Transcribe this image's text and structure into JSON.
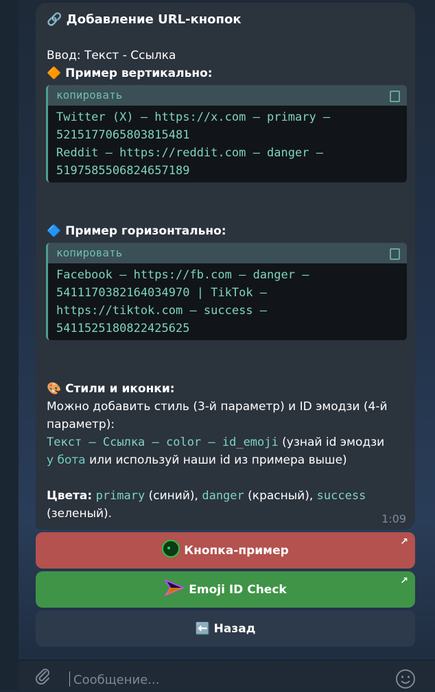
{
  "message": {
    "title": "🔗 Добавление URL-кнопок",
    "input_format": "Ввод: Текст - Ссылка",
    "vertical_heading": "🔶 Пример вертикально:",
    "copy_label": "копировать",
    "vertical_code": [
      "Twitter (X) — https://x.com — primary —",
      "5215177065803815481",
      "Reddit — https://reddit.com — danger —",
      "5197585506824657189"
    ],
    "horizontal_heading": "🔷 Пример горизонтально:",
    "horizontal_code": [
      "Facebook — https://fb.com — danger —",
      "5411170382164034970 | TikTok —",
      "https://tiktok.com — success —",
      "5411525180822425625"
    ],
    "styles_heading": "🎨 Стили и иконки:",
    "styles_text_1": "Можно добавить стиль (3-й параметр) и ID эмодзи (4-й",
    "styles_text_2": "параметр):",
    "format_code": "Текст — Ссылка — color — id_emoji",
    "format_after": " (узнай id эмодзи",
    "bot_link": "у бота",
    "format_after_2": " или используй наши id из примера выше)",
    "colors_label": "Цвета:",
    "color_primary": "primary",
    "color_primary_desc": " (синий), ",
    "color_danger": "danger",
    "color_danger_desc": " (красный), ",
    "color_success": "success",
    "colors_tail": "(зеленый).",
    "time": "1:09"
  },
  "buttons": [
    {
      "label": "Кнопка-пример",
      "color": "#b3524e",
      "icon": "green-circle-icon"
    },
    {
      "label": "Emoji ID Check",
      "color": "#3f9447",
      "icon": "arrow-emoji-icon"
    },
    {
      "label": "⬅️ Назад",
      "color": "#2d3a4b",
      "icon": "back-arrow-icon"
    }
  ],
  "composer": {
    "placeholder": "Сообщение..."
  }
}
